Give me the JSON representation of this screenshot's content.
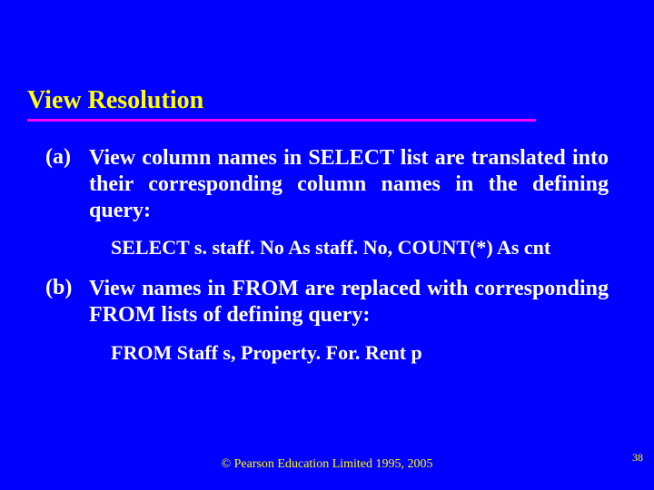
{
  "title": "View Resolution",
  "items": [
    {
      "label": "(a)",
      "text": "View column names in SELECT list are translated into their corresponding column names in the defining query:",
      "code": "SELECT s. staff. No As staff. No, COUNT(*) As cnt"
    },
    {
      "label": "(b)",
      "text": "View names in FROM are replaced with corresponding FROM lists of defining query:",
      "code": "FROM Staff s, Property. For. Rent p"
    }
  ],
  "footer": "© Pearson Education Limited 1995, 2005",
  "page_number": "38"
}
